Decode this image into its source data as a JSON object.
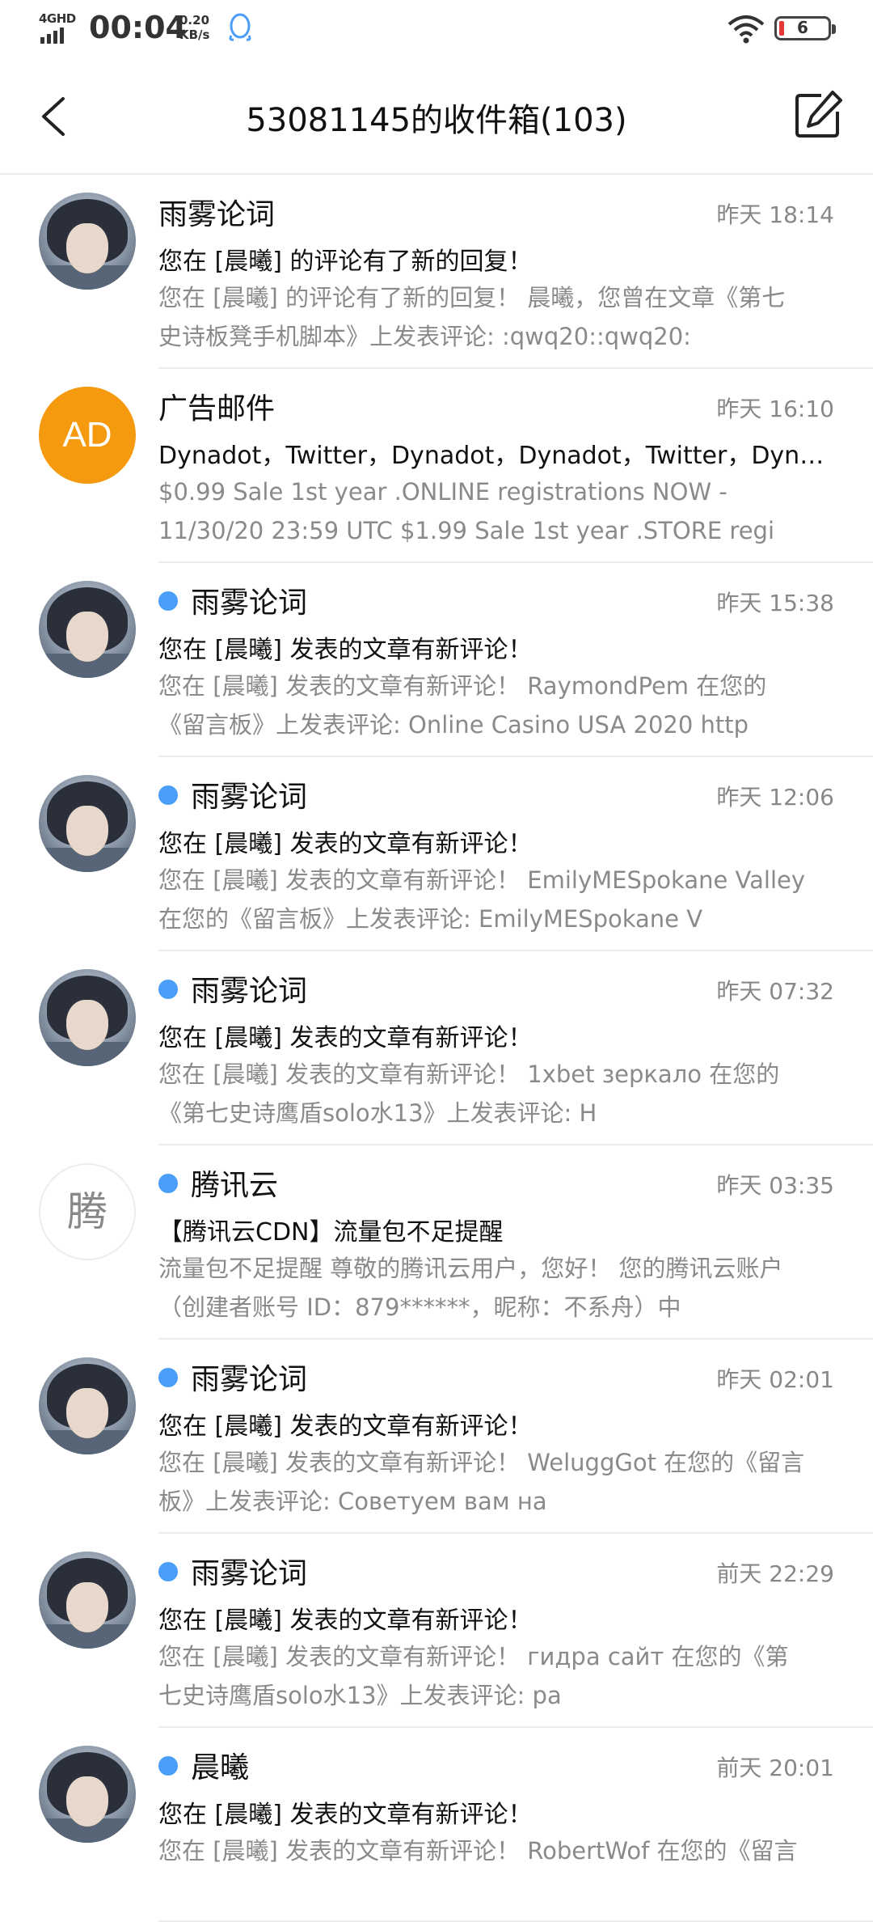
{
  "status_bar": {
    "network": "4GHD",
    "time": "00:04",
    "speed_value": "0.20",
    "speed_unit": "KB/s",
    "battery": "6",
    "icons": [
      "signal-icon",
      "qq-icon",
      "wifi-icon",
      "battery-icon"
    ]
  },
  "header": {
    "title": "53081145的收件箱(103)",
    "back_icon": "chevron-left-icon",
    "compose_icon": "compose-icon"
  },
  "emails": [
    {
      "sender": "雨雾论词",
      "unread": false,
      "time": "昨天 18:14",
      "avatar": "photo",
      "subject": "您在 [晨曦] 的评论有了新的回复！",
      "preview": "您在 [晨曦] 的评论有了新的回复！ 晨曦，您曾在文章《第七史诗板凳手机脚本》上发表评论: :qwq20::qwq20:"
    },
    {
      "sender": "广告邮件",
      "unread": false,
      "time": "昨天 16:10",
      "avatar": "AD",
      "subject": "Dynadot，Twitter，Dynadot，Dynadot，Twitter，Dynadot...",
      "preview": " $0.99 Sale 1st year .ONLINE registrations NOW - 11/30/20  23:59 UTC $1.99 Sale 1st year .STORE regi"
    },
    {
      "sender": "雨雾论词",
      "unread": true,
      "time": "昨天 15:38",
      "avatar": "photo",
      "subject": "您在 [晨曦] 发表的文章有新评论！",
      "preview": "您在 [晨曦] 发表的文章有新评论！ RaymondPem 在您的《留言板》上发表评论: Online Casino USA 2020 http"
    },
    {
      "sender": "雨雾论词",
      "unread": true,
      "time": "昨天 12:06",
      "avatar": "photo",
      "subject": "您在 [晨曦] 发表的文章有新评论！",
      "preview": "您在 [晨曦] 发表的文章有新评论！ EmilyMESpokane Valley 在您的《留言板》上发表评论: EmilyMESpokane V"
    },
    {
      "sender": "雨雾论词",
      "unread": true,
      "time": "昨天 07:32",
      "avatar": "photo",
      "subject": "您在 [晨曦] 发表的文章有新评论！",
      "preview": "您在 [晨曦] 发表的文章有新评论！ 1xbet зеркало 在您的《第七史诗鹰盾solo水13》上发表评论: H"
    },
    {
      "sender": "腾讯云",
      "unread": true,
      "time": "昨天 03:35",
      "avatar": "腾",
      "subject": "【腾讯云CDN】流量包不足提醒",
      "preview": "流量包不足提醒 尊敬的腾讯云用户，您好！ 您的腾讯云账户（创建者账号 ID：879******，昵称：不系舟）中"
    },
    {
      "sender": "雨雾论词",
      "unread": true,
      "time": "昨天 02:01",
      "avatar": "photo",
      "subject": "您在 [晨曦] 发表的文章有新评论！",
      "preview": "您在 [晨曦] 发表的文章有新评论！ WeluggGot 在您的《留言板》上发表评论: Советуем вам на"
    },
    {
      "sender": "雨雾论词",
      "unread": true,
      "time": "前天 22:29",
      "avatar": "photo",
      "subject": "您在 [晨曦] 发表的文章有新评论！",
      "preview": "您在 [晨曦] 发表的文章有新评论！ гидра сайт 在您的《第七史诗鹰盾solo水13》上发表评论: pa"
    },
    {
      "sender": "晨曦",
      "unread": true,
      "time": "前天 20:01",
      "avatar": "photo",
      "subject": "您在 [晨曦] 发表的文章有新评论！",
      "preview": "您在 [晨曦] 发表的文章有新评论！ RobertWof 在您的《留言"
    }
  ],
  "colors": {
    "unread_dot": "#4a9df8",
    "ad_avatar": "#f59a0e",
    "secondary_text": "#8a8a8a"
  }
}
